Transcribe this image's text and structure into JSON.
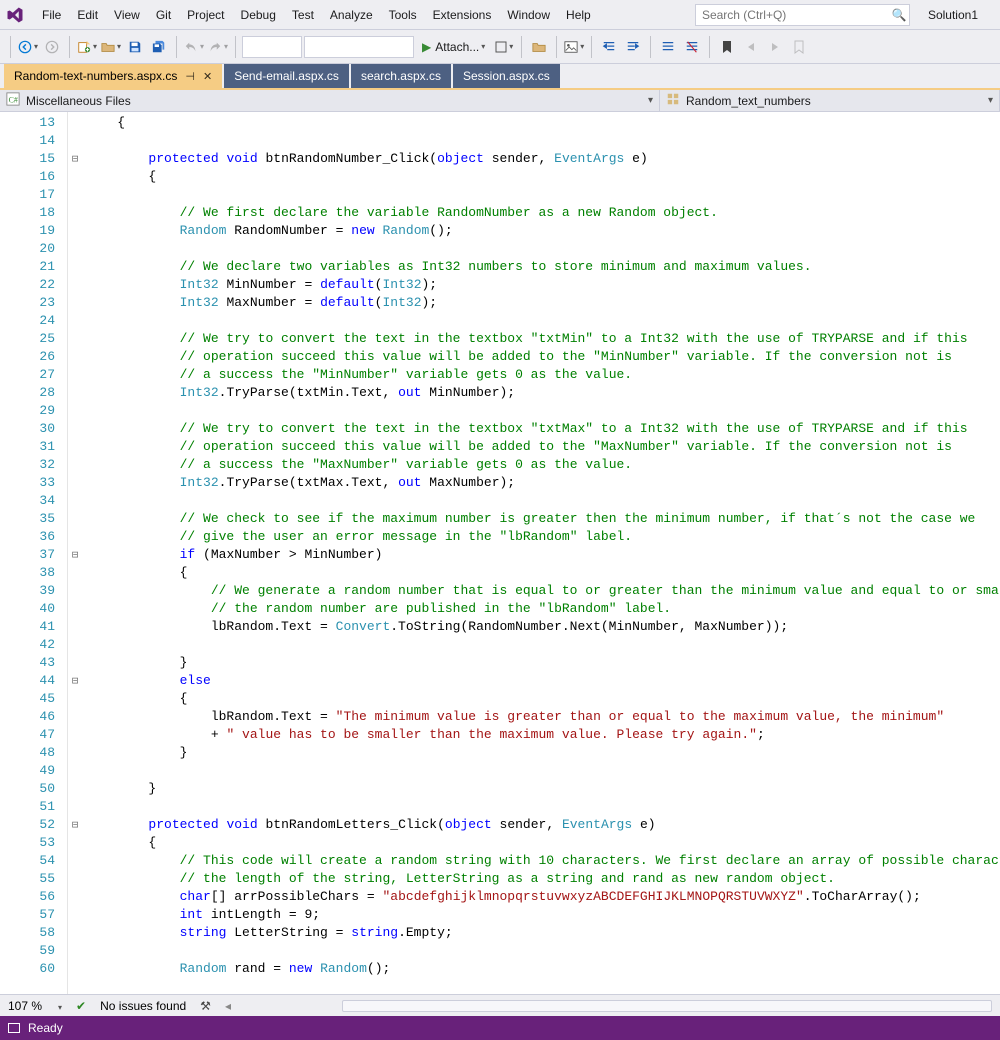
{
  "menu": [
    "File",
    "Edit",
    "View",
    "Git",
    "Project",
    "Debug",
    "Test",
    "Analyze",
    "Tools",
    "Extensions",
    "Window",
    "Help"
  ],
  "search_placeholder": "Search (Ctrl+Q)",
  "solution_name": "Solution1",
  "attach_label": "Attach...",
  "tabs": [
    {
      "label": "Random-text-numbers.aspx.cs",
      "active": true,
      "pinned": true
    },
    {
      "label": "Send-email.aspx.cs",
      "active": false
    },
    {
      "label": "search.aspx.cs",
      "active": false
    },
    {
      "label": "Session.aspx.cs",
      "active": false
    }
  ],
  "nav_left": "Miscellaneous Files",
  "nav_right": "Random_text_numbers",
  "first_line_number": 13,
  "fold_markers": {
    "15": "⊟",
    "37": "⊟",
    "44": "⊟",
    "52": "⊟"
  },
  "code_lines": [
    [
      [
        "",
        "    {"
      ]
    ],
    [
      [
        "",
        ""
      ]
    ],
    [
      [
        "",
        "        "
      ],
      [
        "kw",
        "protected"
      ],
      [
        "",
        " "
      ],
      [
        "kw",
        "void"
      ],
      [
        "",
        " btnRandomNumber_Click("
      ],
      [
        "kw",
        "object"
      ],
      [
        "",
        " sender, "
      ],
      [
        "ty",
        "EventArgs"
      ],
      [
        "",
        " e)"
      ]
    ],
    [
      [
        "",
        "        {"
      ]
    ],
    [
      [
        "",
        ""
      ]
    ],
    [
      [
        "",
        "            "
      ],
      [
        "cm",
        "// We first declare the variable RandomNumber as a new Random object."
      ]
    ],
    [
      [
        "",
        "            "
      ],
      [
        "ty",
        "Random"
      ],
      [
        "",
        " RandomNumber = "
      ],
      [
        "kw",
        "new"
      ],
      [
        "",
        " "
      ],
      [
        "ty",
        "Random"
      ],
      [
        "",
        "();"
      ]
    ],
    [
      [
        "",
        ""
      ]
    ],
    [
      [
        "",
        "            "
      ],
      [
        "cm",
        "// We declare two variables as Int32 numbers to store minimum and maximum values."
      ]
    ],
    [
      [
        "",
        "            "
      ],
      [
        "ty",
        "Int32"
      ],
      [
        "",
        " MinNumber = "
      ],
      [
        "kw",
        "default"
      ],
      [
        "",
        "("
      ],
      [
        "ty",
        "Int32"
      ],
      [
        "",
        ");"
      ]
    ],
    [
      [
        "",
        "            "
      ],
      [
        "ty",
        "Int32"
      ],
      [
        "",
        " MaxNumber = "
      ],
      [
        "kw",
        "default"
      ],
      [
        "",
        "("
      ],
      [
        "ty",
        "Int32"
      ],
      [
        "",
        ");"
      ]
    ],
    [
      [
        "",
        ""
      ]
    ],
    [
      [
        "",
        "            "
      ],
      [
        "cm",
        "// We try to convert the text in the textbox \"txtMin\" to a Int32 with the use of TRYPARSE and if this"
      ]
    ],
    [
      [
        "",
        "            "
      ],
      [
        "cm",
        "// operation succeed this value will be added to the \"MinNumber\" variable. If the conversion not is"
      ]
    ],
    [
      [
        "",
        "            "
      ],
      [
        "cm",
        "// a success the \"MinNumber\" variable gets 0 as the value."
      ]
    ],
    [
      [
        "",
        "            "
      ],
      [
        "ty",
        "Int32"
      ],
      [
        "",
        ".TryParse(txtMin.Text, "
      ],
      [
        "kw",
        "out"
      ],
      [
        "",
        " MinNumber);"
      ]
    ],
    [
      [
        "",
        ""
      ]
    ],
    [
      [
        "",
        "            "
      ],
      [
        "cm",
        "// We try to convert the text in the textbox \"txtMax\" to a Int32 with the use of TRYPARSE and if this"
      ]
    ],
    [
      [
        "",
        "            "
      ],
      [
        "cm",
        "// operation succeed this value will be added to the \"MaxNumber\" variable. If the conversion not is"
      ]
    ],
    [
      [
        "",
        "            "
      ],
      [
        "cm",
        "// a success the \"MaxNumber\" variable gets 0 as the value."
      ]
    ],
    [
      [
        "",
        "            "
      ],
      [
        "ty",
        "Int32"
      ],
      [
        "",
        ".TryParse(txtMax.Text, "
      ],
      [
        "kw",
        "out"
      ],
      [
        "",
        " MaxNumber);"
      ]
    ],
    [
      [
        "",
        ""
      ]
    ],
    [
      [
        "",
        "            "
      ],
      [
        "cm",
        "// We check to see if the maximum number is greater then the minimum number, if that´s not the case we"
      ]
    ],
    [
      [
        "",
        "            "
      ],
      [
        "cm",
        "// give the user an error message in the \"lbRandom\" label."
      ]
    ],
    [
      [
        "",
        "            "
      ],
      [
        "kw",
        "if"
      ],
      [
        "",
        " (MaxNumber > MinNumber)"
      ]
    ],
    [
      [
        "",
        "            {"
      ]
    ],
    [
      [
        "",
        "                "
      ],
      [
        "cm",
        "// We generate a random number that is equal to or greater than the minimum value and equal to or smaller"
      ]
    ],
    [
      [
        "",
        "                "
      ],
      [
        "cm",
        "// the random number are published in the \"lbRandom\" label."
      ]
    ],
    [
      [
        "",
        "                lbRandom.Text = "
      ],
      [
        "ty",
        "Convert"
      ],
      [
        "",
        ".ToString(RandomNumber.Next(MinNumber, MaxNumber));"
      ]
    ],
    [
      [
        "",
        ""
      ]
    ],
    [
      [
        "",
        "            }"
      ]
    ],
    [
      [
        "",
        "            "
      ],
      [
        "kw",
        "else"
      ]
    ],
    [
      [
        "",
        "            {"
      ]
    ],
    [
      [
        "",
        "                lbRandom.Text = "
      ],
      [
        "st",
        "\"The minimum value is greater than or equal to the maximum value, the minimum\""
      ]
    ],
    [
      [
        "",
        "                + "
      ],
      [
        "st",
        "\" value has to be smaller than the maximum value. Please try again.\""
      ],
      [
        "",
        ";"
      ]
    ],
    [
      [
        "",
        "            }"
      ]
    ],
    [
      [
        "",
        ""
      ]
    ],
    [
      [
        "",
        "        }"
      ]
    ],
    [
      [
        "",
        ""
      ]
    ],
    [
      [
        "",
        "        "
      ],
      [
        "kw",
        "protected"
      ],
      [
        "",
        " "
      ],
      [
        "kw",
        "void"
      ],
      [
        "",
        " btnRandomLetters_Click("
      ],
      [
        "kw",
        "object"
      ],
      [
        "",
        " sender, "
      ],
      [
        "ty",
        "EventArgs"
      ],
      [
        "",
        " e)"
      ]
    ],
    [
      [
        "",
        "        {"
      ]
    ],
    [
      [
        "",
        "            "
      ],
      [
        "cm",
        "// This code will create a random string with 10 characters. We first declare an array of possible characters"
      ]
    ],
    [
      [
        "",
        "            "
      ],
      [
        "cm",
        "// the length of the string, LetterString as a string and rand as new random object."
      ]
    ],
    [
      [
        "",
        "            "
      ],
      [
        "kw",
        "char"
      ],
      [
        "",
        "[] arrPossibleChars = "
      ],
      [
        "st",
        "\"abcdefghijklmnopqrstuvwxyzABCDEFGHIJKLMNOPQRSTUVWXYZ\""
      ],
      [
        "",
        ".ToCharArray();"
      ]
    ],
    [
      [
        "",
        "            "
      ],
      [
        "kw",
        "int"
      ],
      [
        "",
        " intLength = 9;"
      ]
    ],
    [
      [
        "",
        "            "
      ],
      [
        "kw",
        "string"
      ],
      [
        "",
        " LetterString = "
      ],
      [
        "kw",
        "string"
      ],
      [
        "",
        ".Empty;"
      ]
    ],
    [
      [
        "",
        ""
      ]
    ],
    [
      [
        "",
        "            "
      ],
      [
        "ty",
        "Random"
      ],
      [
        "",
        " rand = "
      ],
      [
        "kw",
        "new"
      ],
      [
        "",
        " "
      ],
      [
        "ty",
        "Random"
      ],
      [
        "",
        "();"
      ]
    ]
  ],
  "zoom": "107 %",
  "issues": "No issues found",
  "status_text": "Ready"
}
